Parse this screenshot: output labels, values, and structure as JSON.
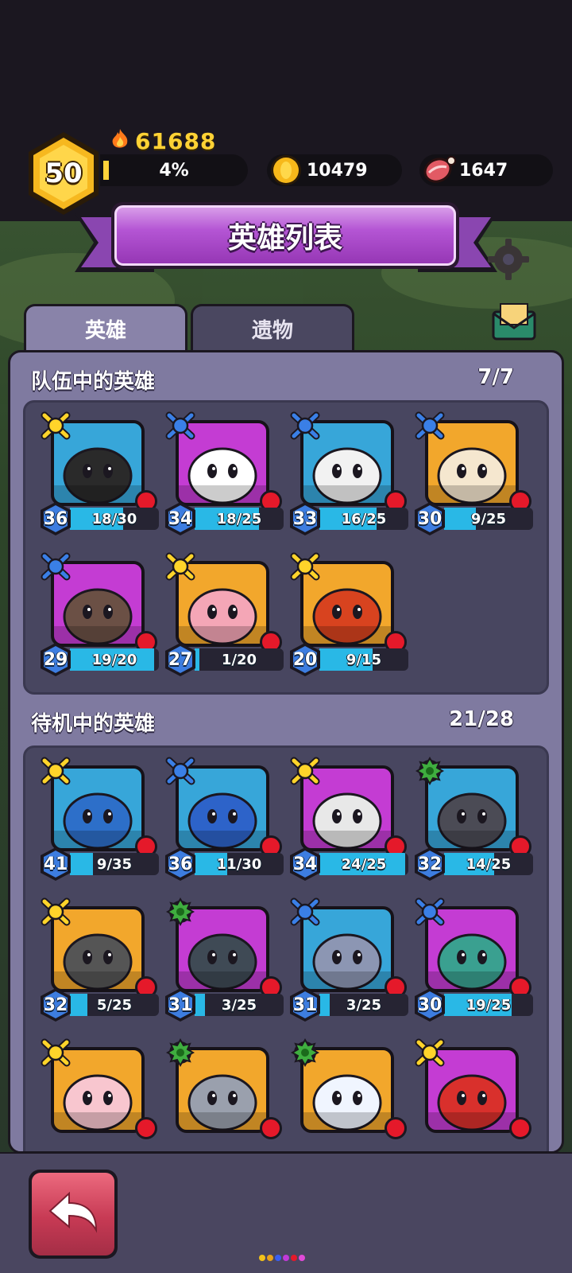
{
  "hud": {
    "level": "50",
    "power": "61688",
    "xp_percent_label": "4%",
    "xp_fraction": 0.04,
    "coins": "10479",
    "meat": "1647"
  },
  "title": "英雄列表",
  "tabs": [
    {
      "label": "英雄",
      "active": true
    },
    {
      "label": "遗物",
      "active": false
    }
  ],
  "team": {
    "title": "队伍中的英雄",
    "count": "7/7",
    "heroes": [
      {
        "level": "36",
        "progress": "18/30",
        "fill": 0.6,
        "rank": "yellow",
        "bg": "#37a6d9"
      },
      {
        "level": "34",
        "progress": "18/25",
        "fill": 0.72,
        "rank": "blue",
        "bg": "#c43cd3"
      },
      {
        "level": "33",
        "progress": "16/25",
        "fill": 0.64,
        "rank": "blue",
        "bg": "#37a6d9"
      },
      {
        "level": "30",
        "progress": "9/25",
        "fill": 0.36,
        "rank": "blue",
        "bg": "#f2a72c"
      },
      {
        "level": "29",
        "progress": "19/20",
        "fill": 0.95,
        "rank": "blue",
        "bg": "#c43cd3"
      },
      {
        "level": "27",
        "progress": "1/20",
        "fill": 0.05,
        "rank": "yellow",
        "bg": "#f2a72c"
      },
      {
        "level": "20",
        "progress": "9/15",
        "fill": 0.6,
        "rank": "yellow",
        "bg": "#f2a72c"
      }
    ]
  },
  "standby": {
    "title": "待机中的英雄",
    "count": "21/28",
    "heroes": [
      {
        "level": "41",
        "progress": "9/35",
        "fill": 0.26,
        "rank": "yellow",
        "bg": "#37a6d9"
      },
      {
        "level": "36",
        "progress": "11/30",
        "fill": 0.37,
        "rank": "blue",
        "bg": "#37a6d9"
      },
      {
        "level": "34",
        "progress": "24/25",
        "fill": 0.96,
        "rank": "yellow",
        "bg": "#c43cd3"
      },
      {
        "level": "32",
        "progress": "14/25",
        "fill": 0.56,
        "rank": "green",
        "bg": "#37a6d9"
      },
      {
        "level": "32",
        "progress": "5/25",
        "fill": 0.2,
        "rank": "yellow",
        "bg": "#f2a72c"
      },
      {
        "level": "31",
        "progress": "3/25",
        "fill": 0.12,
        "rank": "green",
        "bg": "#c43cd3"
      },
      {
        "level": "31",
        "progress": "3/25",
        "fill": 0.12,
        "rank": "blue",
        "bg": "#37a6d9"
      },
      {
        "level": "30",
        "progress": "19/25",
        "fill": 0.76,
        "rank": "blue",
        "bg": "#c43cd3"
      },
      {
        "level": "",
        "progress": "",
        "fill": 0,
        "rank": "yellow",
        "bg": "#f2a72c"
      },
      {
        "level": "",
        "progress": "",
        "fill": 0,
        "rank": "green",
        "bg": "#f2a72c"
      },
      {
        "level": "",
        "progress": "",
        "fill": 0,
        "rank": "green",
        "bg": "#f2a72c"
      },
      {
        "level": "",
        "progress": "",
        "fill": 0,
        "rank": "yellow",
        "bg": "#c43cd3"
      }
    ]
  },
  "colors": {
    "accent_gold": "#ffd235",
    "title_purple": "#b455d4",
    "panel": "#7f7aa0",
    "progress_blue": "#29b8e6",
    "alert_red": "#e5192a",
    "back_button": "#c73a54"
  },
  "icons": [
    "flame-icon",
    "coin-icon",
    "meat-icon",
    "gear-icon",
    "mail-icon",
    "back-arrow-icon"
  ]
}
